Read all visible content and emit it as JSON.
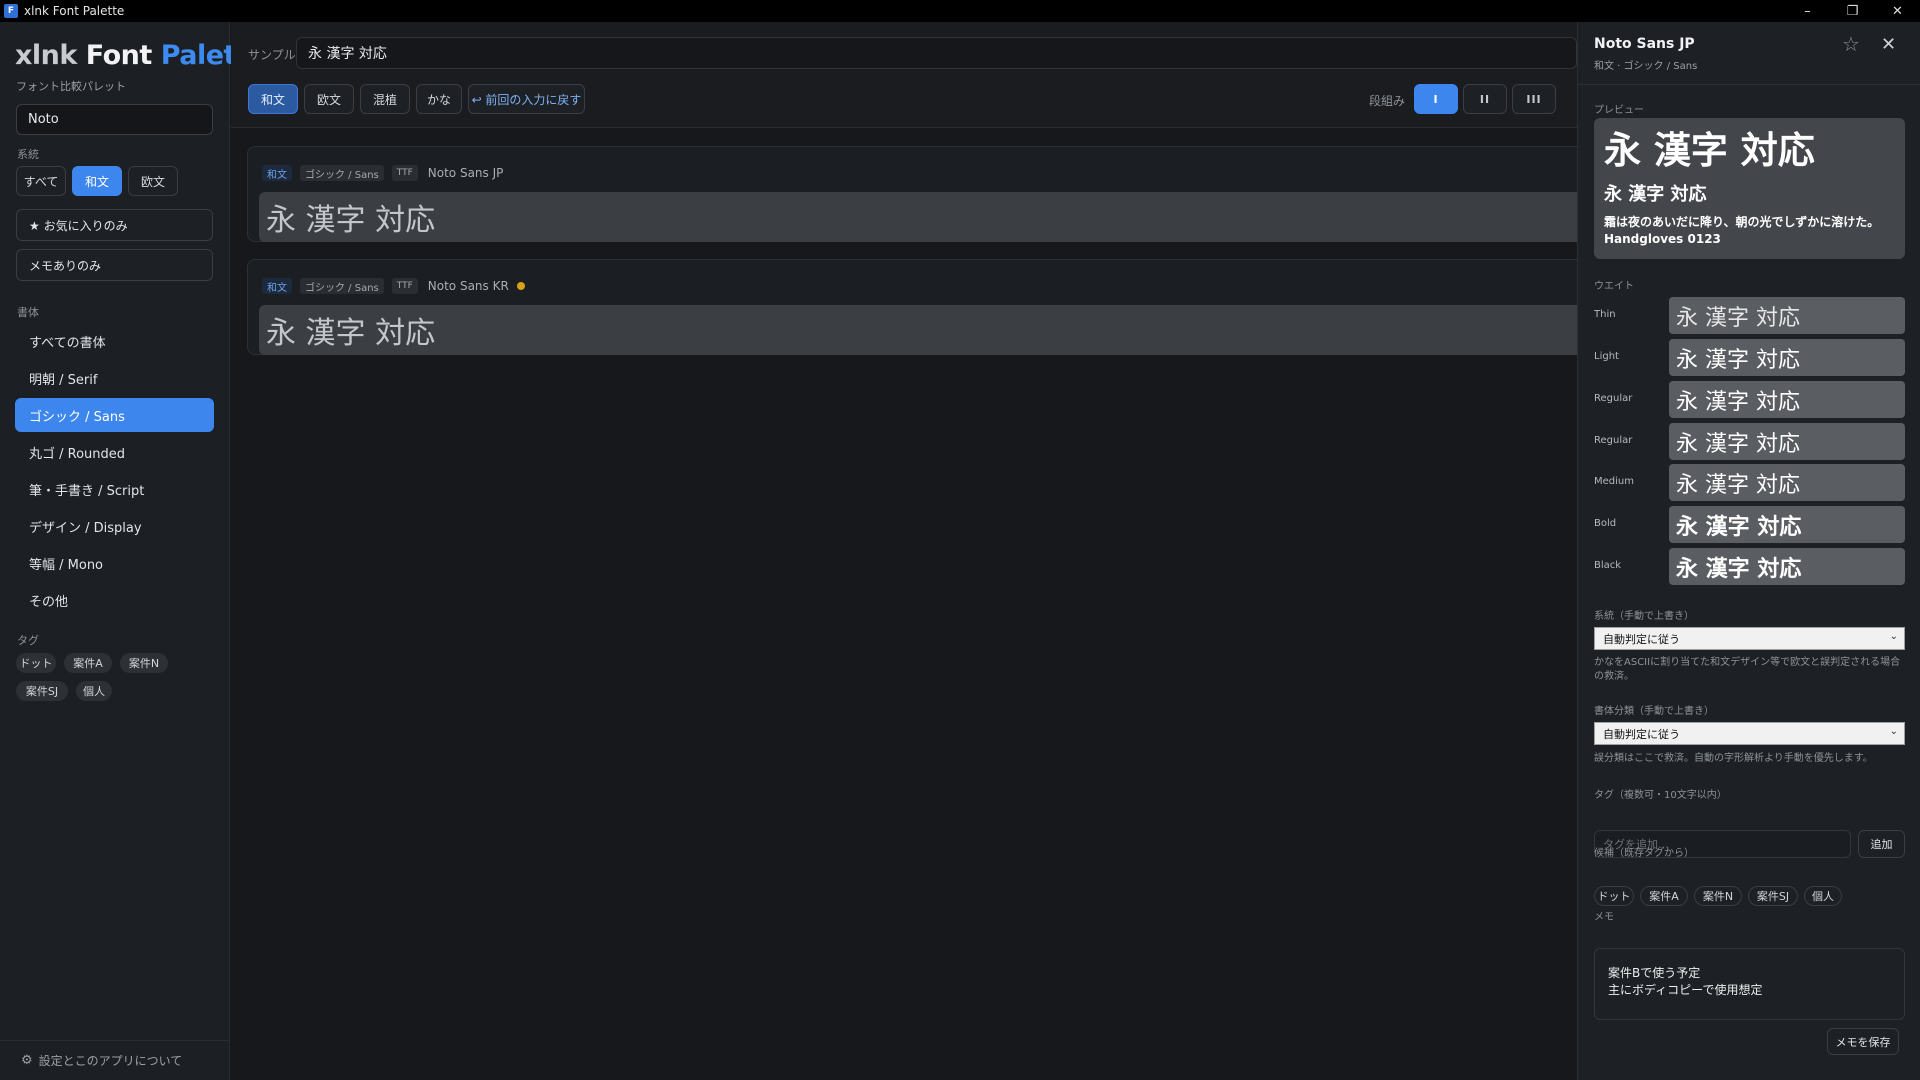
{
  "window": {
    "title": "xlnk Font Palette",
    "icon": "app-icon",
    "icon_text": "F",
    "controls": {
      "minimize": "–",
      "restore": "❐",
      "close": "✕"
    }
  },
  "sidebar": {
    "logo": {
      "part1": "xlnk",
      "part2": "Font",
      "part3": "Palette"
    },
    "logo_subtitle": "フォント比較パレット",
    "search_value": "Noto",
    "script_label": "系統",
    "script_filters": [
      "すべて",
      "和文",
      "欧文"
    ],
    "script_selected": "和文",
    "favorites_only": "★ お気に入りのみ",
    "memo_only": "メモありのみ",
    "style_label": "書体",
    "styles": [
      "すべての書体",
      "明朝 / Serif",
      "ゴシック / Sans",
      "丸ゴ / Rounded",
      "筆・手書き / Script",
      "デザイン / Display",
      "等幅 / Mono",
      "その他"
    ],
    "style_selected": "ゴシック / Sans",
    "tags_label": "タグ",
    "tags": [
      "ドット",
      "案件A",
      "案件N",
      "案件SJ",
      "個人"
    ],
    "footer": "設定とこのアプリについて"
  },
  "toolbar": {
    "sample_label": "サンプル",
    "sample_value": "永 漢字 対応",
    "modes": [
      "和文",
      "欧文",
      "混植",
      "かな"
    ],
    "mode_selected": "和文",
    "restore_previous": "↩ 前回の入力に戻す",
    "columns_label": "段組み",
    "columns": [
      "I",
      "II",
      "III"
    ],
    "columns_selected": "I"
  },
  "fonts": [
    {
      "kind": "和文",
      "classification": "ゴシック / Sans",
      "format": "TTF",
      "name": "Noto Sans JP",
      "has_memo": false,
      "preview": "永 漢字 対応"
    },
    {
      "kind": "和文",
      "classification": "ゴシック / Sans",
      "format": "TTF",
      "name": "Noto Sans KR",
      "has_memo": true,
      "preview": "永 漢字 対応"
    }
  ],
  "detail": {
    "name": "Noto Sans JP",
    "subtitle": "和文 · ゴシック / Sans",
    "preview_label": "プレビュー",
    "preview_large": "永 漢字 対応",
    "preview_medium": "永 漢字 対応",
    "preview_body": "霜は夜のあいだに降り、朝の光でしずかに溶けた。 Handgloves 0123",
    "weights_label": "ウエイト",
    "weights": [
      {
        "label": "Thin",
        "sample": "永 漢字 対応",
        "weight": 100
      },
      {
        "label": "Light",
        "sample": "永 漢字 対応",
        "weight": 300
      },
      {
        "label": "Regular",
        "sample": "永 漢字 対応",
        "weight": 400
      },
      {
        "label": "Regular",
        "sample": "永 漢字 対応",
        "weight": 400
      },
      {
        "label": "Medium",
        "sample": "永 漢字 対応",
        "weight": 500
      },
      {
        "label": "Bold",
        "sample": "永 漢字 対応",
        "weight": 700
      },
      {
        "label": "Black",
        "sample": "永 漢字 対応",
        "weight": 900
      }
    ],
    "script_override_label": "系統（手動で上書き）",
    "script_override_value": "自動判定に従う",
    "script_override_hint": "かなをASCIIに割り当てた和文デザイン等で欧文と誤判定される場合の救済。",
    "class_override_label": "書体分類（手動で上書き）",
    "class_override_value": "自動判定に従う",
    "class_override_hint": "誤分類はここで救済。自動の字形解析より手動を優先します。",
    "tags_label": "タグ（複数可・10文字以内）",
    "tag_placeholder": "タグを追加…",
    "add_button": "追加",
    "candidates_label": "候補（既存タグから）",
    "candidate_tags": [
      "ドット",
      "案件A",
      "案件N",
      "案件SJ",
      "個人"
    ],
    "memo_label": "メモ",
    "memo_lines": [
      "案件Bで使う予定",
      "主にボディコピーで使用想定"
    ],
    "save_memo": "メモを保存"
  },
  "colors": {
    "accent": "#3d86ee",
    "memo_dot": "#d6a21a",
    "background": "#16181b"
  }
}
